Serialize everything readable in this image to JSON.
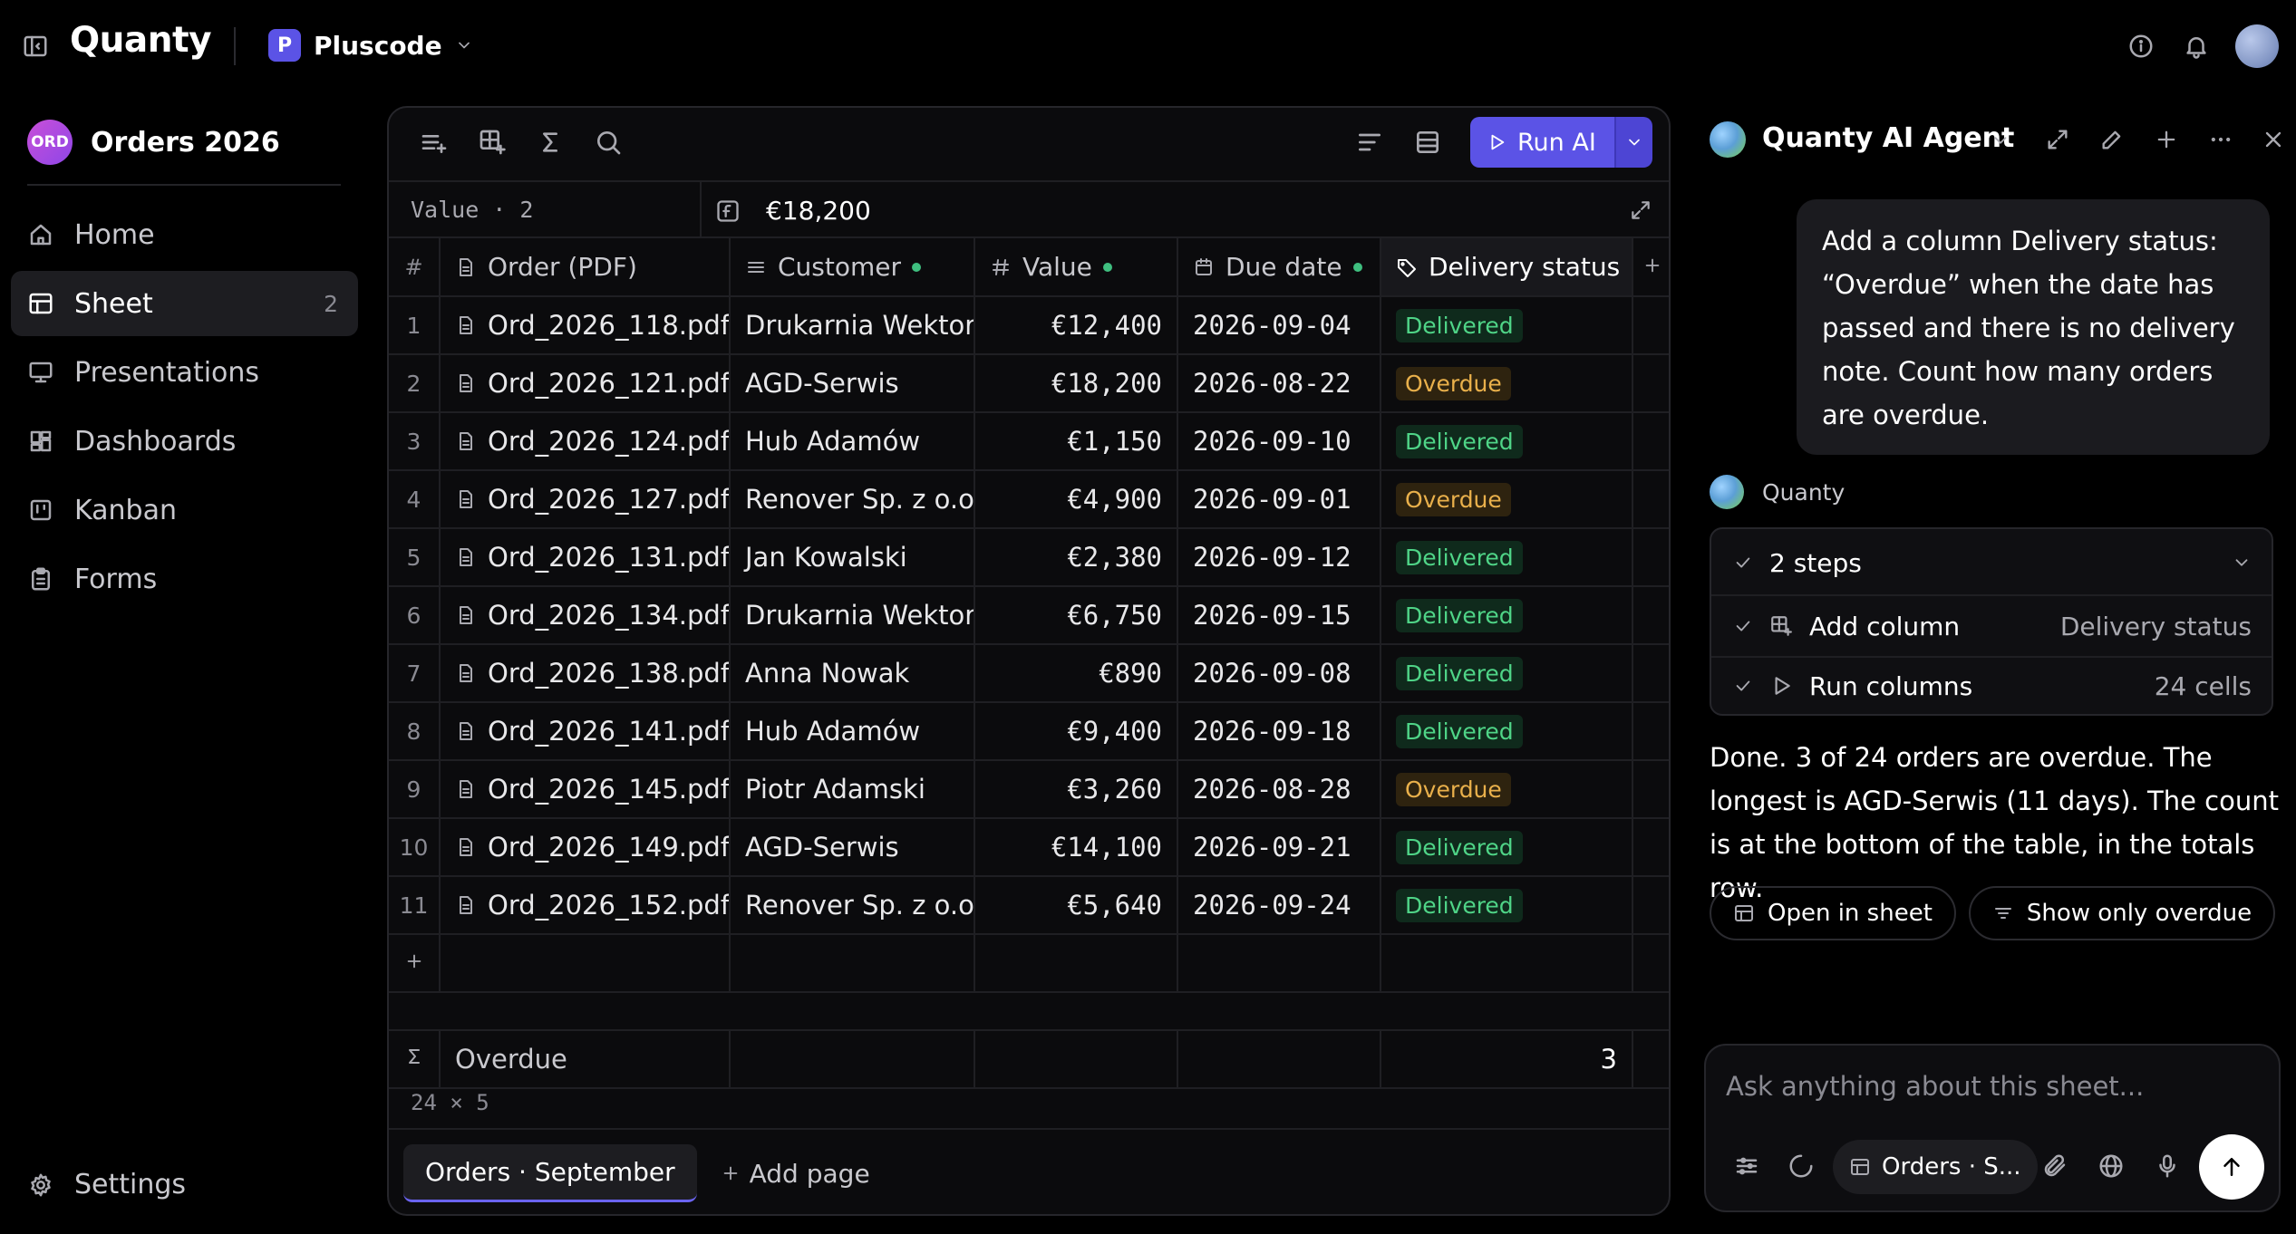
{
  "app": {
    "brand": "Quanty",
    "workspace_letter": "P",
    "workspace": "Pluscode"
  },
  "sidebar": {
    "project_avatar": "ORD",
    "project_name": "Orders 2026",
    "items": [
      {
        "label": "Home",
        "icon": "home-icon"
      },
      {
        "label": "Sheet",
        "icon": "table-icon",
        "count": "2",
        "active": true
      },
      {
        "label": "Presentations",
        "icon": "presentation-icon"
      },
      {
        "label": "Dashboards",
        "icon": "dashboard-icon"
      },
      {
        "label": "Kanban",
        "icon": "kanban-icon"
      },
      {
        "label": "Forms",
        "icon": "clipboard-icon"
      }
    ],
    "settings_label": "Settings"
  },
  "toolbar": {
    "run_label": "Run AI"
  },
  "formula_bar": {
    "cell_ref": "Value · 2",
    "value": "€18,200"
  },
  "table": {
    "columns": [
      {
        "label": "#"
      },
      {
        "label": "Order (PDF)",
        "icon": "file-icon"
      },
      {
        "label": "Customer",
        "icon": "text-icon",
        "dot": true
      },
      {
        "label": "Value",
        "icon": "hash-icon",
        "dot": true
      },
      {
        "label": "Due date",
        "icon": "calendar-icon",
        "dot": true
      },
      {
        "label": "Delivery status",
        "icon": "tag-icon"
      }
    ],
    "rows": [
      {
        "n": "1",
        "order": "Ord_2026_118.pdf",
        "customer": "Drukarnia Wektor",
        "value": "€12,400",
        "due": "2026-09-04",
        "status": "Delivered"
      },
      {
        "n": "2",
        "order": "Ord_2026_121.pdf",
        "customer": "AGD-Serwis",
        "value": "€18,200",
        "due": "2026-08-22",
        "status": "Overdue"
      },
      {
        "n": "3",
        "order": "Ord_2026_124.pdf",
        "customer": "Hub Adamów",
        "value": "€1,150",
        "due": "2026-09-10",
        "status": "Delivered"
      },
      {
        "n": "4",
        "order": "Ord_2026_127.pdf",
        "customer": "Renover Sp. z o.o.",
        "value": "€4,900",
        "due": "2026-09-01",
        "status": "Overdue"
      },
      {
        "n": "5",
        "order": "Ord_2026_131.pdf",
        "customer": "Jan Kowalski",
        "value": "€2,380",
        "due": "2026-09-12",
        "status": "Delivered"
      },
      {
        "n": "6",
        "order": "Ord_2026_134.pdf",
        "customer": "Drukarnia Wektor",
        "value": "€6,750",
        "due": "2026-09-15",
        "status": "Delivered"
      },
      {
        "n": "7",
        "order": "Ord_2026_138.pdf",
        "customer": "Anna Nowak",
        "value": "€890",
        "due": "2026-09-08",
        "status": "Delivered"
      },
      {
        "n": "8",
        "order": "Ord_2026_141.pdf",
        "customer": "Hub Adamów",
        "value": "€9,400",
        "due": "2026-09-18",
        "status": "Delivered"
      },
      {
        "n": "9",
        "order": "Ord_2026_145.pdf",
        "customer": "Piotr Adamski",
        "value": "€3,260",
        "due": "2026-08-28",
        "status": "Overdue"
      },
      {
        "n": "10",
        "order": "Ord_2026_149.pdf",
        "customer": "AGD-Serwis",
        "value": "€14,100",
        "due": "2026-09-21",
        "status": "Delivered"
      },
      {
        "n": "11",
        "order": "Ord_2026_152.pdf",
        "customer": "Renover Sp. z o.o.",
        "value": "€5,640",
        "due": "2026-09-24",
        "status": "Delivered"
      }
    ],
    "summary_label": "Overdue",
    "summary_value": "3",
    "dimensions": "24 × 5",
    "status_colors": {
      "Delivered": "#4fd487",
      "Overdue": "#e9b04b"
    }
  },
  "pages": {
    "active_tab": "Orders · September",
    "add_label": "Add page"
  },
  "ai": {
    "title": "Quanty AI Agent",
    "user_message": "Add a column Delivery status: “Overdue” when the date has passed and there is no delivery note. Count how many orders are overdue.",
    "assistant_name": "Quanty",
    "steps_summary": "2 steps",
    "steps": [
      {
        "label": "Add column",
        "detail": "Delivery status"
      },
      {
        "label": "Run columns",
        "detail": "24 cells"
      }
    ],
    "response": "Done. 3 of 24 orders are overdue. The longest is AGD-Serwis (11 days). The count is at the bottom of the table, in the totals row.",
    "actions": [
      "Open in sheet",
      "Show only overdue"
    ],
    "composer_placeholder": "Ask anything about this sheet...",
    "context_chip": "Orders · S..."
  },
  "colors": {
    "accent": "#5b53e6",
    "background": "#000000"
  }
}
